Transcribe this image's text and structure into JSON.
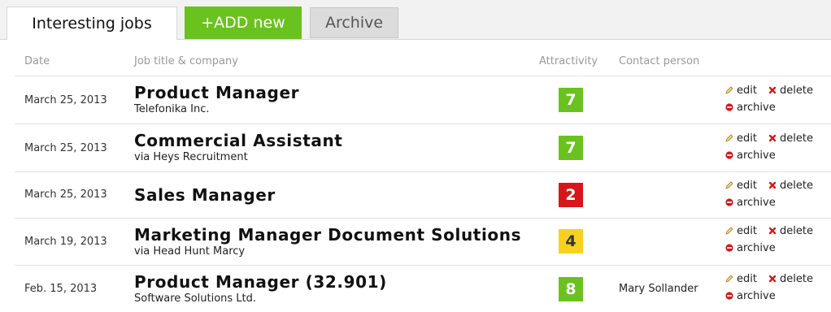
{
  "tabs": {
    "interesting_label": "Interesting jobs",
    "add_label": "+ADD new",
    "archive_label": "Archive"
  },
  "colors": {
    "tab_add": "#6ac21e",
    "attractivity_high": "#6ac21e",
    "attractivity_low": "#d7161b",
    "attractivity_mid": "#f7d11e"
  },
  "table": {
    "headers": {
      "date": "Date",
      "job": "Job title & company",
      "attractivity": "Attractivity",
      "contact": "Contact person"
    },
    "rows": [
      {
        "date": "March 25, 2013",
        "title": "Product Manager",
        "company": "Telefonika Inc.",
        "attractivity": "7",
        "level": "high",
        "contact": ""
      },
      {
        "date": "March 25, 2013",
        "title": "Commercial Assistant",
        "company": "via Heys Recruitment",
        "attractivity": "7",
        "level": "high",
        "contact": ""
      },
      {
        "date": "March 25, 2013",
        "title": "Sales Manager",
        "company": "",
        "attractivity": "2",
        "level": "low",
        "contact": ""
      },
      {
        "date": "March 19, 2013",
        "title": "Marketing Manager Document Solutions",
        "company": "via Head Hunt Marcy",
        "attractivity": "4",
        "level": "mid",
        "contact": ""
      },
      {
        "date": "Feb. 15, 2013",
        "title": "Product Manager (32.901)",
        "company": "Software Solutions Ltd.",
        "attractivity": "8",
        "level": "high",
        "contact": "Mary Sollander"
      }
    ],
    "actions": {
      "edit": "edit",
      "delete": "delete",
      "archive": "archive"
    }
  }
}
